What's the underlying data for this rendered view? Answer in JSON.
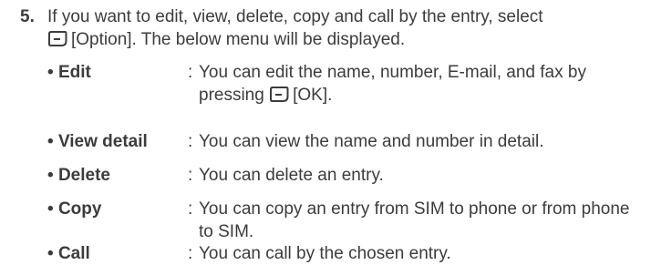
{
  "step": {
    "number": "5.",
    "line1": "If you want to edit, view, delete, copy and call by the entry, select",
    "line2": "[Option]. The below menu will be displayed."
  },
  "menu": {
    "bullet": "•",
    "separator": ":",
    "items": [
      {
        "label": "Edit",
        "desc_line1": "You can edit the name, number, E-mail, and fax by",
        "desc_line2_prefix": "pressing",
        "desc_line2_suffix": "[OK]."
      },
      {
        "label": "View detail",
        "desc": "You can view the name and number in detail."
      },
      {
        "label": "Delete",
        "desc": "You can delete an entry."
      },
      {
        "label": "Copy",
        "desc_line1": "You can copy an entry from SIM to phone or from phone",
        "desc_line2": "to SIM."
      },
      {
        "label": "Call",
        "desc": "You can call by the chosen entry."
      }
    ]
  },
  "icons": {
    "softkey": "left-softkey-icon"
  },
  "colors": {
    "text": "#3c3c3c"
  }
}
